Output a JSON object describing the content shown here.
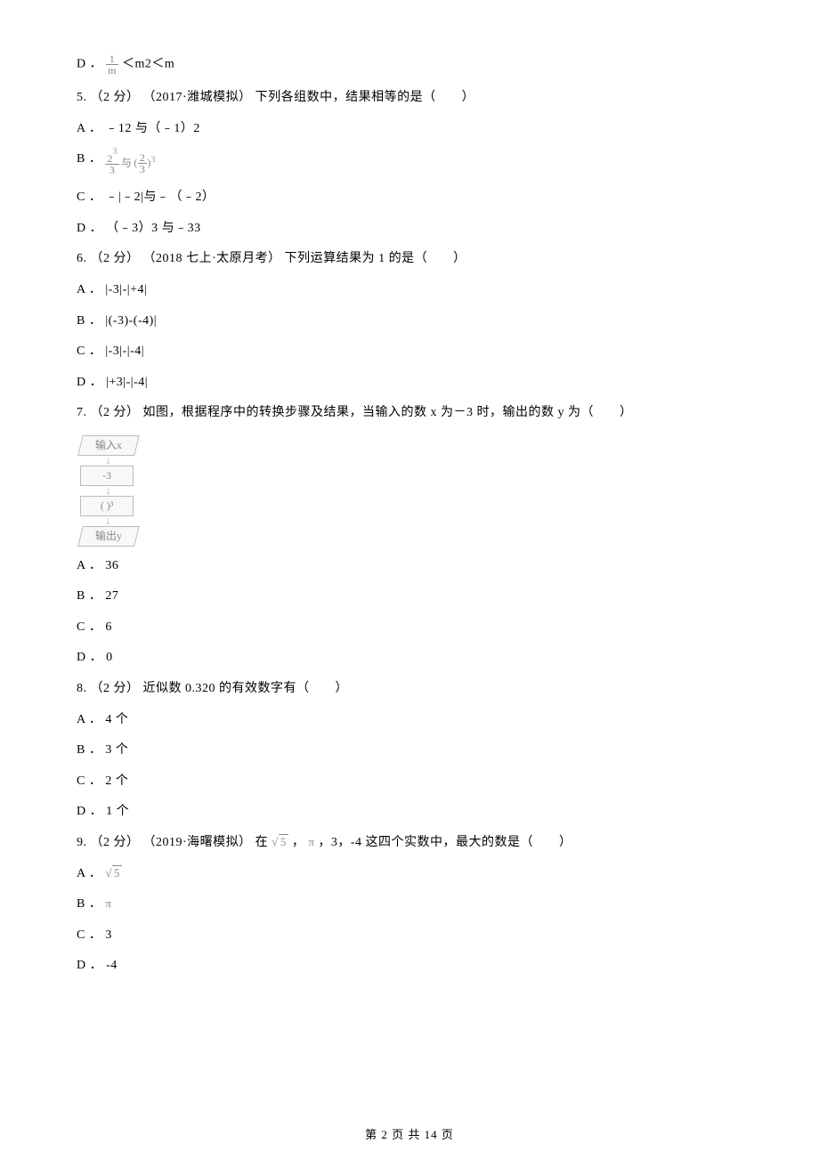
{
  "q4": {
    "optD_prefix": "D ．",
    "optD_suffix": " ＜m2＜m"
  },
  "q5": {
    "stem": "5.  （2 分） （2017·潍城模拟） 下列各组数中，结果相等的是（　　）",
    "optA": "A ． ﹣12 与（﹣1）2",
    "optB_prefix": "B ．",
    "optC": "C ． ﹣|﹣2|与﹣（﹣2）",
    "optD": "D ． （﹣3）3 与﹣33"
  },
  "q6": {
    "stem": "6.  （2 分） （2018 七上·太原月考） 下列运算结果为 1 的是（　　）",
    "optA": "A ． |-3|-|+4|",
    "optB": "B ． |(-3)-(-4)|",
    "optC": "C ． |-3|-|-4|",
    "optD": "D ． |+3|-|-4|"
  },
  "q7": {
    "stem": "7.  （2 分）  如图，根据程序中的转换步骤及结果，当输入的数 x 为－3 时，输出的数 y 为（　　）",
    "flow_input": "输入x",
    "flow_step1": "-3",
    "flow_step2": "(    )³",
    "flow_output": "输出y",
    "optA": "A ． 36",
    "optB": "B ． 27",
    "optC": "C ． 6",
    "optD": "D ． 0"
  },
  "q8": {
    "stem": "8.  （2 分）  近似数 0.320 的有效数字有（　　）",
    "optA": "A ． 4 个",
    "optB": "B ． 3 个",
    "optC": "C ． 2 个",
    "optD": "D ． 1 个"
  },
  "q9": {
    "stem_prefix": "9.  （2 分） （2019·海曙模拟） 在",
    "stem_mid": " ， ",
    "stem_suffix": " ，3，-4 这四个实数中，最大的数是（　　）",
    "optA_prefix": "A ．",
    "optB_prefix": "B ．",
    "optC": "C ． 3",
    "optD": "D ． -4"
  },
  "pagefoot": "第 2 页 共 14 页",
  "math": {
    "one_over_m_num": "1",
    "one_over_m_den": "m",
    "two_cubed": "2",
    "three_exp": "3",
    "three_den": "3",
    "q5b_yu": "与",
    "two_thirds_num": "2",
    "two_thirds_den": "3",
    "sqrt5_val": "5",
    "pi": "π"
  }
}
